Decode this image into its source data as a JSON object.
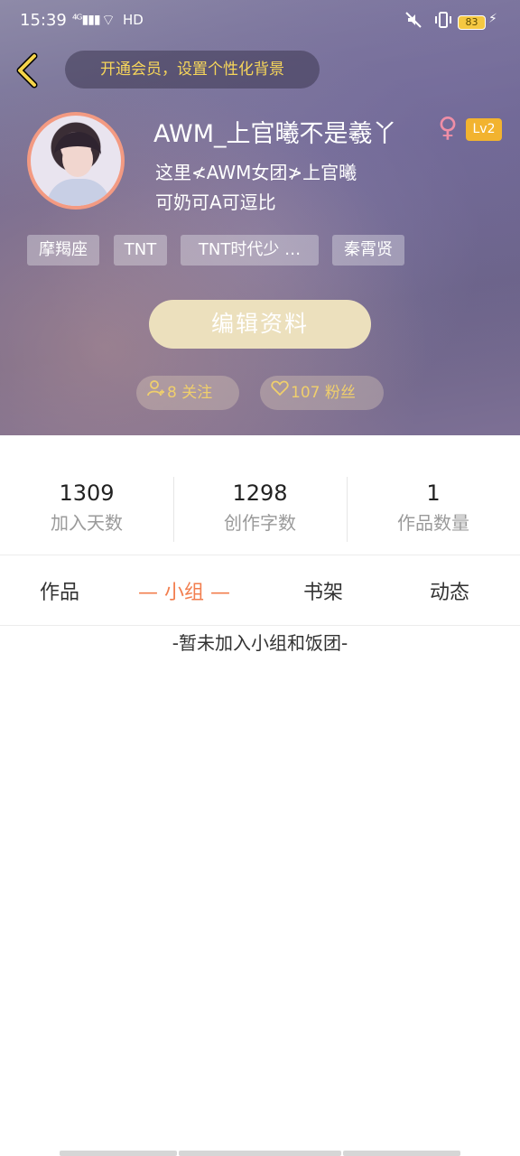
{
  "status_bar": {
    "time": "15:39",
    "signal": "⁴ᴳ▮▮▮",
    "wifi_icon": "⌔",
    "hd": "HD",
    "battery": "83"
  },
  "header": {
    "vip_banner": "开通会员，设置个性化背景",
    "username": "AWM_上官曦不是羲丫",
    "gender_symbol": "♀",
    "level": "Lv2",
    "bio": "这里≮AWM女团≯上官曦\n可奶可A可逗比",
    "tags": [
      "摩羯座",
      "TNT",
      "TNT时代少 …",
      "秦霄贤"
    ],
    "edit_button": "编辑资料",
    "follow": "8 关注",
    "fans": "107 粉丝"
  },
  "stats": [
    {
      "value": "1309",
      "label": "加入天数"
    },
    {
      "value": "1298",
      "label": "创作字数"
    },
    {
      "value": "1",
      "label": "作品数量"
    }
  ],
  "tabs": {
    "works": "作品",
    "groups": "— 小组 —",
    "shelf": "书架",
    "feed": "动态"
  },
  "empty_text": "-暂未加入小组和饭团-",
  "colors": {
    "accent": "#f27e4e",
    "gold": "#f0cf6c",
    "level_badge": "#f2b32f",
    "edit_button": "#ece0bd"
  }
}
